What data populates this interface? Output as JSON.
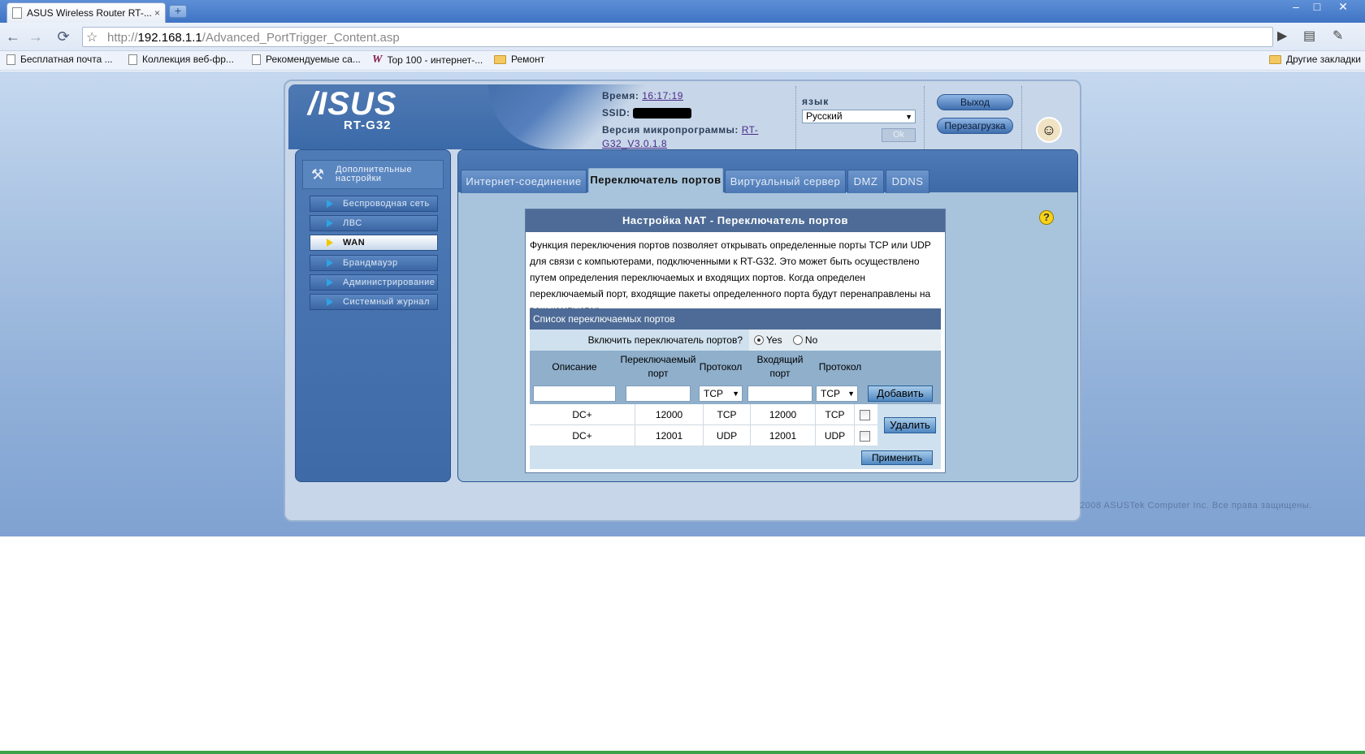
{
  "browser": {
    "tab_title": "ASUS Wireless Router RT-...",
    "tab_close": "×",
    "new_tab": "+",
    "window_controls": [
      "–",
      "□",
      "✕"
    ],
    "url_prefix": "http://",
    "url_host": "192.168.1.1",
    "url_path": "/Advanced_PortTrigger_Content.asp",
    "bookmarks": [
      {
        "label": "Бесплатная почта ...",
        "icon": "page-icon"
      },
      {
        "label": "Коллекция веб-фр...",
        "icon": "page-icon"
      },
      {
        "label": "Рекомендуемые са...",
        "icon": "page-icon"
      },
      {
        "label": "Top 100 - интернет-...",
        "icon": "w-icon"
      },
      {
        "label": "Ремонт",
        "icon": "folder-icon"
      }
    ],
    "other_bookmarks": "Другие закладки"
  },
  "header": {
    "logo": "/ISUS",
    "model": "RT-G32",
    "time_label": "Время:",
    "time_value": "16:17:19",
    "ssid_label": "SSID:",
    "firmware_label": "Версия микропрограммы:",
    "firmware_value_1": "RT-",
    "firmware_value_2": "G32_V3.0.1.8",
    "language_label": "язык",
    "language_value": "Русский",
    "ok_label": "Ok",
    "logout_label": "Выход",
    "reboot_label": "Перезагрузка"
  },
  "sidebar": {
    "title_line1": "Дополнительные",
    "title_line2": "настройки",
    "items": [
      {
        "label": "Беспроводная сеть"
      },
      {
        "label": "ЛВС"
      },
      {
        "label": "WAN"
      },
      {
        "label": "Брандмауэр"
      },
      {
        "label": "Администрирование"
      },
      {
        "label": "Системный журнал"
      }
    ]
  },
  "tabs": [
    {
      "label": "Интернет-соединение"
    },
    {
      "label": "Переключатель портов"
    },
    {
      "label": "Виртуальный сервер"
    },
    {
      "label": "DMZ"
    },
    {
      "label": "DDNS"
    }
  ],
  "help": "?",
  "nat": {
    "title": "Настройка NAT - Переключатель портов",
    "description": "Функция переключения портов позволяет открывать определенные порты TCP или UDP для связи с компьютерами, подключенными к RT-G32. Это может быть осуществлено путем определения переключаемых и входящих портов. Когда определен переключаемый порт, входящие пакеты определенного порта будут перенаправлены на ваш компьютер.",
    "list_title": "Список переключаемых портов",
    "enable_label": "Включить переключатель портов?",
    "yes": "Yes",
    "no": "No",
    "enabled": "Yes",
    "columns": {
      "description": "Описание",
      "trigger_port_1": "Переключаемый",
      "trigger_port_2": "порт",
      "protocol": "Протокол",
      "incoming_port_1": "Входящий",
      "incoming_port_2": "порт",
      "protocol2": "Протокол"
    },
    "new_entry": {
      "description": "",
      "trigger_port": "",
      "trigger_protocol": "TCP",
      "incoming_port": "",
      "incoming_protocol": "TCP"
    },
    "add_label": "Добавить",
    "rows": [
      {
        "description": "DC+",
        "trigger_port": "12000",
        "trigger_protocol": "TCP",
        "incoming_port": "12000",
        "incoming_protocol": "TCP"
      },
      {
        "description": "DC+",
        "trigger_port": "12001",
        "trigger_protocol": "UDP",
        "incoming_port": "12001",
        "incoming_protocol": "UDP"
      }
    ],
    "delete_label": "Удалить",
    "apply_label": "Применить"
  },
  "copyright": "2008 ASUSTek Computer Inc. Все права защищены."
}
